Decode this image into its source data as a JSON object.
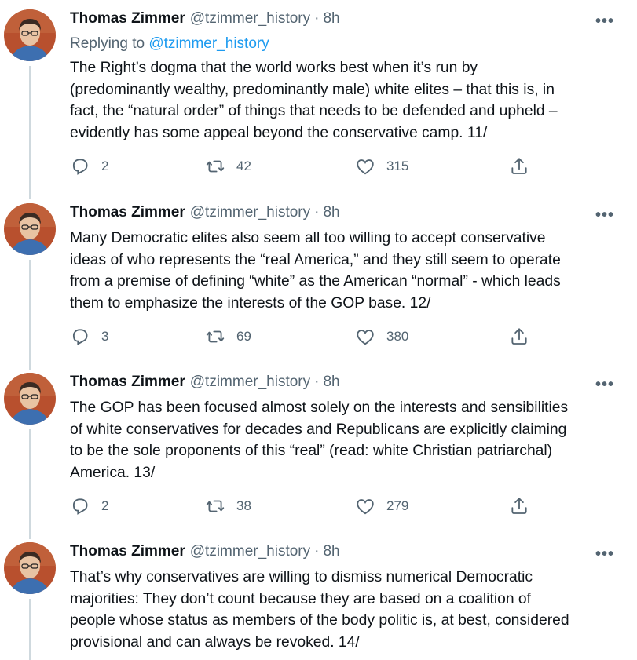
{
  "thread": {
    "tweets": [
      {
        "name": "Thomas Zimmer",
        "handle": "@tzimmer_history",
        "separator": "·",
        "time": "8h",
        "more_label": "•••",
        "replying_prefix": "Replying to",
        "replying_to": "@tzimmer_history",
        "lines": [
          "The Right’s dogma that the world works best when it’s run by",
          "(predominantly wealthy, predominantly male) white elites – that this is, in",
          "fact, the “natural order” of things that needs to be defended and upheld –",
          "evidently has some appeal beyond the conservative camp. 11/"
        ],
        "replies": "2",
        "retweets": "42",
        "likes": "315"
      },
      {
        "name": "Thomas Zimmer",
        "handle": "@tzimmer_history",
        "separator": "·",
        "time": "8h",
        "more_label": "•••",
        "lines": [
          "Many Democratic elites also seem all too willing to accept conservative",
          "ideas of who represents the “real America,” and they still seem to operate",
          "from a premise of defining “white” as the American “normal” - which leads",
          "them to emphasize the interests of the GOP base. 12/"
        ],
        "replies": "3",
        "retweets": "69",
        "likes": "380"
      },
      {
        "name": "Thomas Zimmer",
        "handle": "@tzimmer_history",
        "separator": "·",
        "time": "8h",
        "more_label": "•••",
        "lines": [
          "The GOP has been focused almost solely on the interests and sensibilities",
          "of white conservatives for decades and Republicans are explicitly claiming",
          "to be the sole proponents of this “real” (read: white Christian patriarchal)",
          "America. 13/"
        ],
        "replies": "2",
        "retweets": "38",
        "likes": "279"
      },
      {
        "name": "Thomas Zimmer",
        "handle": "@tzimmer_history",
        "separator": "·",
        "time": "8h",
        "more_label": "•••",
        "lines": [
          "That’s why conservatives are willing to dismiss numerical Democratic",
          "majorities: They don’t count because they are based on a coalition of",
          "people whose status as members of the body politic is, at best, considered",
          "provisional and can always be revoked. 14/"
        ]
      }
    ]
  },
  "colors": {
    "text": "#0f1419",
    "secondary": "#536471",
    "link": "#1d9bf0",
    "thread_line": "#cfd9de",
    "avatar_background": "#b8502e"
  },
  "icons": {
    "reply": "reply-icon",
    "retweet": "retweet-icon",
    "like": "like-icon",
    "share": "share-icon",
    "more": "more-icon"
  }
}
